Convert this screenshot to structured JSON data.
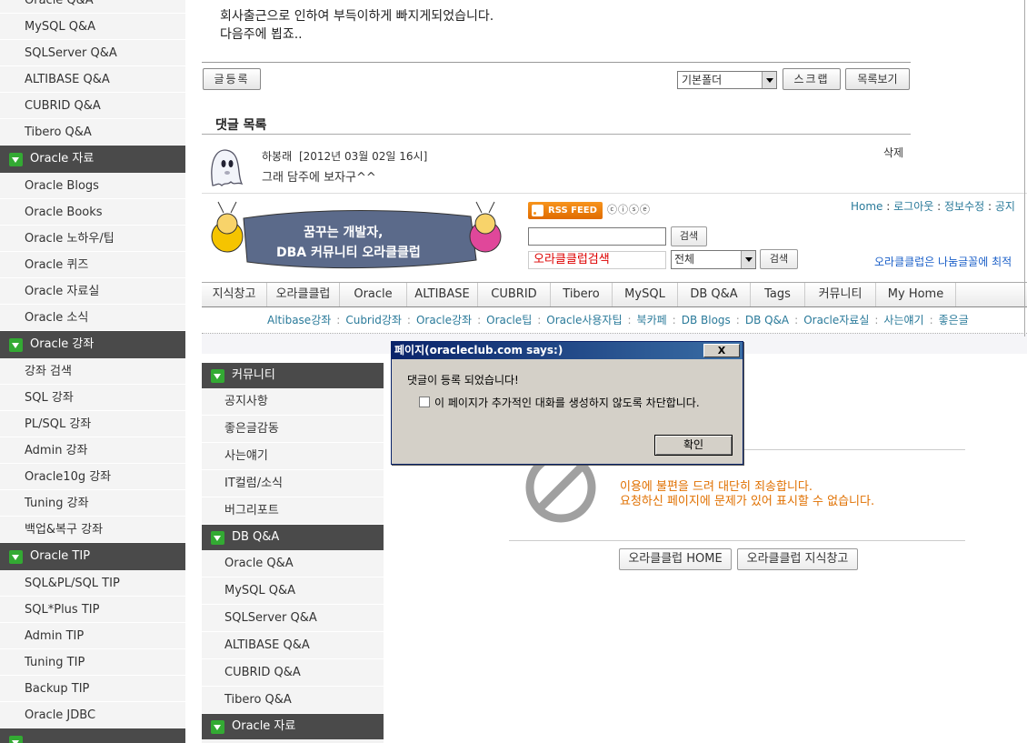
{
  "left_sidebar": {
    "groups": [
      {
        "type": "items",
        "items": [
          "Oracle Q&A",
          "MySQL Q&A",
          "SQLServer Q&A",
          "ALTIBASE Q&A",
          "CUBRID Q&A",
          "Tibero Q&A"
        ]
      },
      {
        "type": "head",
        "label": "Oracle 자료"
      },
      {
        "type": "items",
        "items": [
          "Oracle Blogs",
          "Oracle Books",
          "Oracle 노하우/팁",
          "Oracle 퀴즈",
          "Oracle 자료실",
          "Oracle 소식"
        ]
      },
      {
        "type": "head",
        "label": "Oracle 강좌"
      },
      {
        "type": "items",
        "items": [
          "강좌 검색",
          "SQL 강좌",
          "PL/SQL 강좌",
          "Admin 강좌",
          "Oracle10g 강좌",
          "Tuning 강좌",
          "백업&복구 강좌"
        ]
      },
      {
        "type": "head",
        "label": "Oracle TIP"
      },
      {
        "type": "items",
        "items": [
          "SQL&PL/SQL TIP",
          "SQL*Plus TIP",
          "Admin TIP",
          "Tuning TIP",
          "Backup TIP",
          "Oracle JDBC"
        ]
      },
      {
        "type": "head",
        "label": ""
      }
    ]
  },
  "post": {
    "line1": "회사출근으로 인하여 부득이하게 빠지게되었습니다.",
    "line2": "다음주에 뵙죠.."
  },
  "toolbar": {
    "write_label": "글등록",
    "folder_value": "기본폴더",
    "scrap_label": "스크랩",
    "list_label": "목록보기"
  },
  "comments": {
    "title": "댓글 목록",
    "items": [
      {
        "author": "하봉래",
        "date": "[2012년 03월 02일 16시]",
        "body": "그래 담주에 보자구^^",
        "delete": "삭제"
      }
    ]
  },
  "site_header": {
    "banner_line1": "꿈꾸는 개발자,",
    "banner_line2": "DBA 커뮤니티 오라클클럽",
    "rss_label": "RSS FEED",
    "cc_label": "ⓒⓘⓢⓔ",
    "top_links": [
      "Home",
      "로그아웃",
      "정보수정",
      "공지"
    ],
    "search_button": "검색",
    "search2_value": "오라클클럽검색",
    "search2_select": "전체",
    "search2_button": "검색",
    "notice": "오라클클럽은 나눔글꼴에 최적"
  },
  "nav_tabs": [
    "지식창고",
    "오라클클럽",
    "Oracle",
    "ALTIBASE",
    "CUBRID",
    "Tibero",
    "MySQL",
    "DB Q&A",
    "Tags",
    "커뮤니티",
    "My Home"
  ],
  "sub_nav": [
    "Altibase강좌",
    "Cubrid강좌",
    "Oracle강좌",
    "Oracle팁",
    "Oracle사용자팁",
    "북카페",
    "DB Blogs",
    "DB Q&A",
    "Oracle자료실",
    "사는얘기",
    "좋은글"
  ],
  "inner_sidebar": {
    "groups": [
      {
        "type": "head",
        "label": "커뮤니티"
      },
      {
        "type": "items",
        "items": [
          "공지사항",
          "좋은글감동",
          "사는얘기",
          "IT컬럼/소식",
          "버그리포트"
        ]
      },
      {
        "type": "head",
        "label": "DB Q&A"
      },
      {
        "type": "items",
        "items": [
          "Oracle Q&A",
          "MySQL Q&A",
          "SQLServer Q&A",
          "ALTIBASE Q&A",
          "CUBRID Q&A",
          "Tibero Q&A"
        ]
      },
      {
        "type": "head",
        "label": "Oracle 자료"
      }
    ]
  },
  "error_page": {
    "line1": "이용에 불편을 드려 대단히 죄송합니다.",
    "line2": "요청하신 페이지에 문제가 있어 표시할 수 없습니다.",
    "home_button": "오라클클럽 HOME",
    "knowledge_button": "오라클클럽 지식창고"
  },
  "dialog": {
    "title": "페이지(oracleclub.com says:)",
    "close": "X",
    "message": "댓글이 등록 되었습니다!",
    "checkbox_label": "이 페이지가 추가적인 대화를 생성하지 않도록 차단합니다.",
    "ok_label": "확인"
  }
}
